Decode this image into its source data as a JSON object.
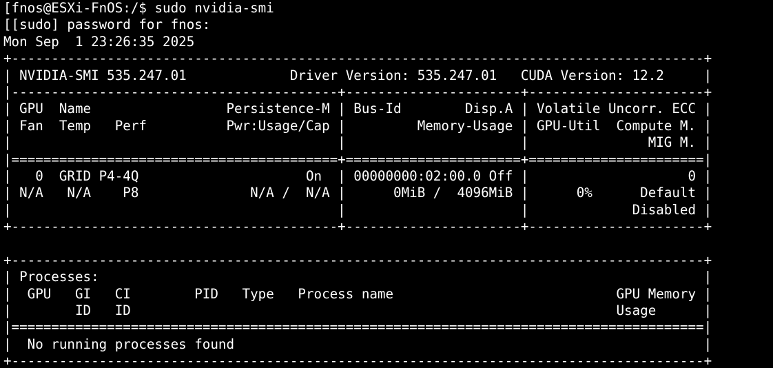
{
  "terminal": {
    "lines": [
      "[fnos@ESXi-FnOS:/$ sudo nvidia-smi",
      "[[sudo] password for fnos:",
      "Mon Sep  1 23:26:35 2025",
      "+---------------------------------------------------------------------------------------+",
      "| NVIDIA-SMI 535.247.01             Driver Version: 535.247.01   CUDA Version: 12.2     |",
      "|-----------------------------------------+----------------------+----------------------+",
      "| GPU  Name                 Persistence-M | Bus-Id        Disp.A | Volatile Uncorr. ECC |",
      "| Fan  Temp   Perf          Pwr:Usage/Cap |         Memory-Usage | GPU-Util  Compute M. |",
      "|                                         |                      |               MIG M. |",
      "|=========================================+======================+======================|",
      "|   0  GRID P4-4Q                     On  | 00000000:02:00.0 Off |                    0 |",
      "| N/A   N/A    P8              N/A /  N/A |      0MiB /  4096MiB |      0%      Default |",
      "|                                         |                      |             Disabled |",
      "+-----------------------------------------+----------------------+----------------------+",
      "",
      "+---------------------------------------------------------------------------------------+",
      "| Processes:                                                                            |",
      "|  GPU   GI   CI        PID   Type   Process name                            GPU Memory |",
      "|        ID   ID                                                             Usage      |",
      "|=======================================================================================|",
      "|  No running processes found                                                           |",
      "+---------------------------------------------------------------------------------------+"
    ]
  }
}
